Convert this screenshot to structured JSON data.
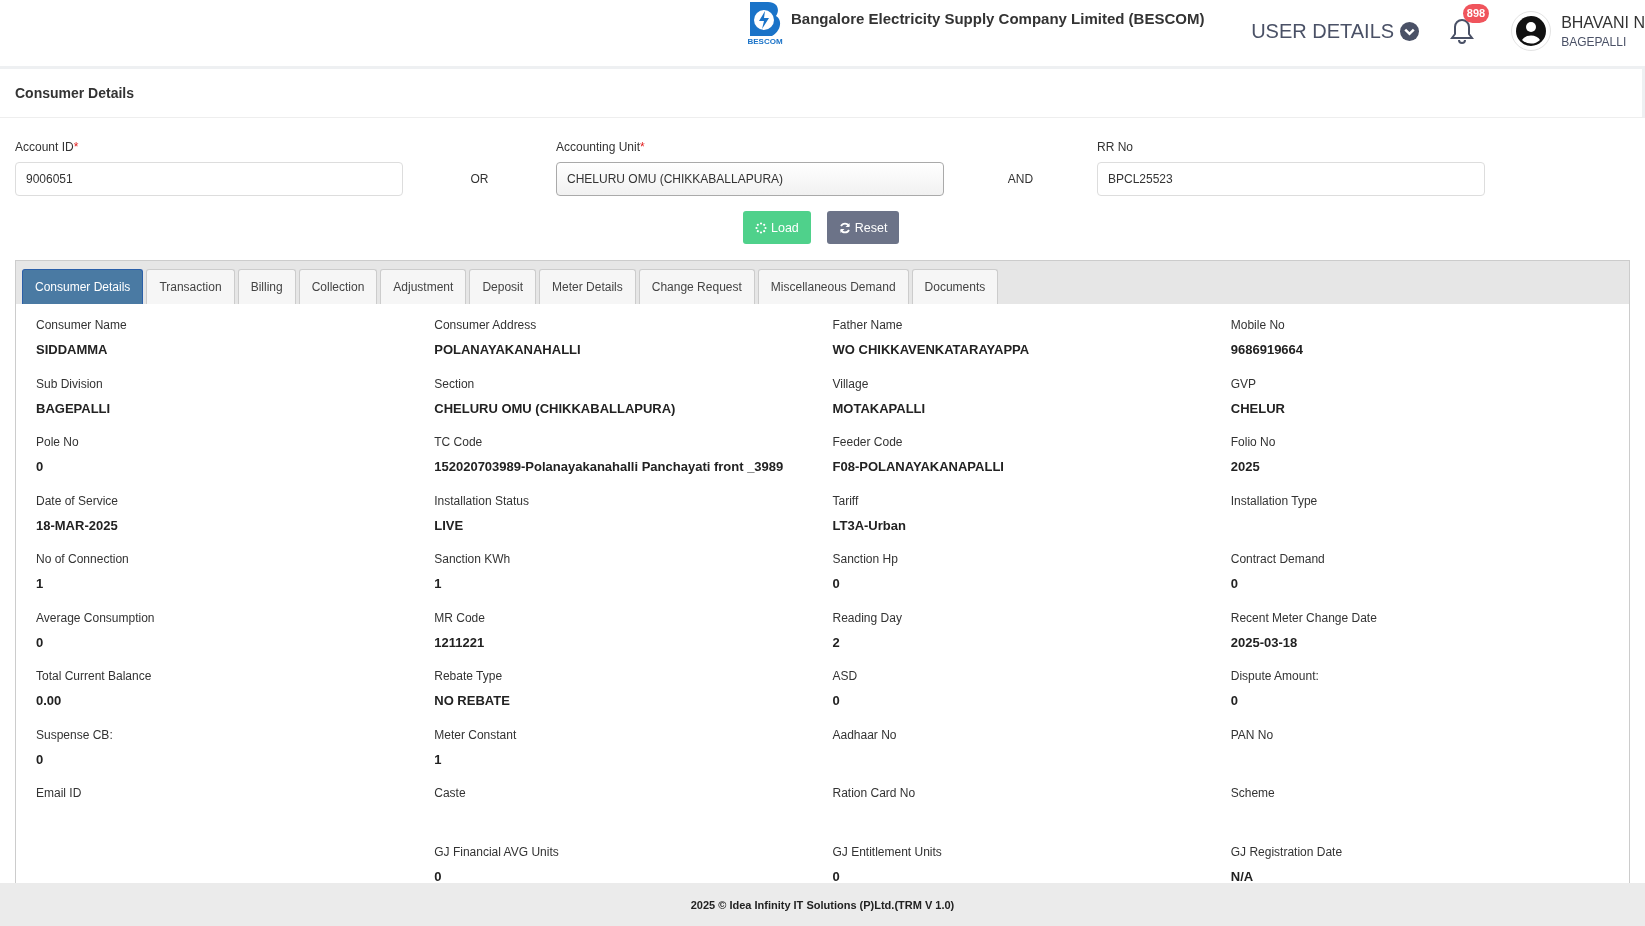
{
  "header": {
    "logo_caption": "BESCOM",
    "company": "Bangalore Electricity Supply Company Limited (BESCOM)",
    "user_details": "USER DETAILS",
    "notification_count": "898",
    "user_name": "BHAVANI N",
    "user_location": "BAGEPALLI"
  },
  "page_title": "Consumer Details",
  "search": {
    "fields": [
      {
        "label": "Account ID",
        "required_mark": "*",
        "value": "9006051",
        "kind": "text"
      },
      {
        "kind": "separator",
        "text": "OR"
      },
      {
        "label": "Accounting Unit",
        "required_mark": "*",
        "value": "CHELURU OMU (CHIKKABALLAPURA)",
        "kind": "select"
      },
      {
        "kind": "separator",
        "text": "AND"
      },
      {
        "label": "RR No",
        "value": "BPCL25523",
        "kind": "text"
      }
    ],
    "buttons": [
      {
        "label": "Load",
        "kind": "load"
      },
      {
        "label": "Reset",
        "kind": "reset"
      }
    ]
  },
  "tabs": [
    {
      "label": "Consumer Details",
      "selected": true
    },
    {
      "label": "Transaction",
      "selected": false
    },
    {
      "label": "Billing",
      "selected": false
    },
    {
      "label": "Collection",
      "selected": false
    },
    {
      "label": "Adjustment",
      "selected": false
    },
    {
      "label": "Deposit",
      "selected": false
    },
    {
      "label": "Meter Details",
      "selected": false
    },
    {
      "label": "Change Request",
      "selected": false
    },
    {
      "label": "Miscellaneous Demand",
      "selected": false
    },
    {
      "label": "Documents",
      "selected": false
    }
  ],
  "details": [
    [
      {
        "label": "Consumer Name",
        "value": "SIDDAMMA"
      },
      {
        "label": "Consumer Address",
        "value": "POLANAYAKANAHALLI"
      },
      {
        "label": "Father Name",
        "value": "WO CHIKKAVENKATARAYAPPA"
      },
      {
        "label": "Mobile No",
        "value": "9686919664"
      }
    ],
    [
      {
        "label": "Sub Division",
        "value": "BAGEPALLI"
      },
      {
        "label": "Section",
        "value": "CHELURU OMU (CHIKKABALLAPURA)"
      },
      {
        "label": "Village",
        "value": "MOTAKAPALLI"
      },
      {
        "label": "GVP",
        "value": "CHELUR"
      }
    ],
    [
      {
        "label": "Pole No",
        "value": "0"
      },
      {
        "label": "TC Code",
        "value": "152020703989-Polanayakanahalli Panchayati front _3989"
      },
      {
        "label": "Feeder Code",
        "value": "F08-POLANAYAKANAPALLI"
      },
      {
        "label": "Folio No",
        "value": "2025"
      }
    ],
    [
      {
        "label": "Date of Service",
        "value": "18-MAR-2025"
      },
      {
        "label": "Installation Status",
        "value": "LIVE"
      },
      {
        "label": "Tariff",
        "value": "LT3A-Urban"
      },
      {
        "label": "Installation Type"
      }
    ],
    [
      {
        "label": "No of Connection",
        "value": "1"
      },
      {
        "label": "Sanction KWh",
        "value": "1"
      },
      {
        "label": "Sanction Hp",
        "value": "0"
      },
      {
        "label": "Contract Demand",
        "value": "0"
      }
    ],
    [
      {
        "label": "Average Consumption",
        "value": "0"
      },
      {
        "label": "MR Code",
        "value": "1211221"
      },
      {
        "label": "Reading Day",
        "value": "2"
      },
      {
        "label": "Recent Meter Change Date",
        "value": "2025-03-18"
      }
    ],
    [
      {
        "label": "Total Current Balance",
        "value": "0.00"
      },
      {
        "label": "Rebate Type",
        "value": "NO REBATE"
      },
      {
        "label": "ASD",
        "value": "0"
      },
      {
        "label": "Dispute Amount:",
        "value": "0"
      }
    ],
    [
      {
        "label": "Suspense CB:",
        "value": "0"
      },
      {
        "label": "Meter Constant",
        "value": "1"
      },
      {
        "label": "Aadhaar No"
      },
      {
        "label": "PAN No"
      }
    ],
    [
      {
        "label": "Email ID"
      },
      {
        "label": "Caste"
      },
      {
        "label": "Ration Card No"
      },
      {
        "label": "Scheme"
      }
    ],
    [
      {
        "label": "GJ Financial AVG Units",
        "value": "0"
      },
      {
        "label": "GJ Entitlement Units",
        "value": "0"
      },
      {
        "label": "GJ Registration Date",
        "value": "N/A"
      }
    ]
  ],
  "footer": "2025 © Idea Infinity IT Solutions (P)Ltd.(TRM V 1.0)"
}
